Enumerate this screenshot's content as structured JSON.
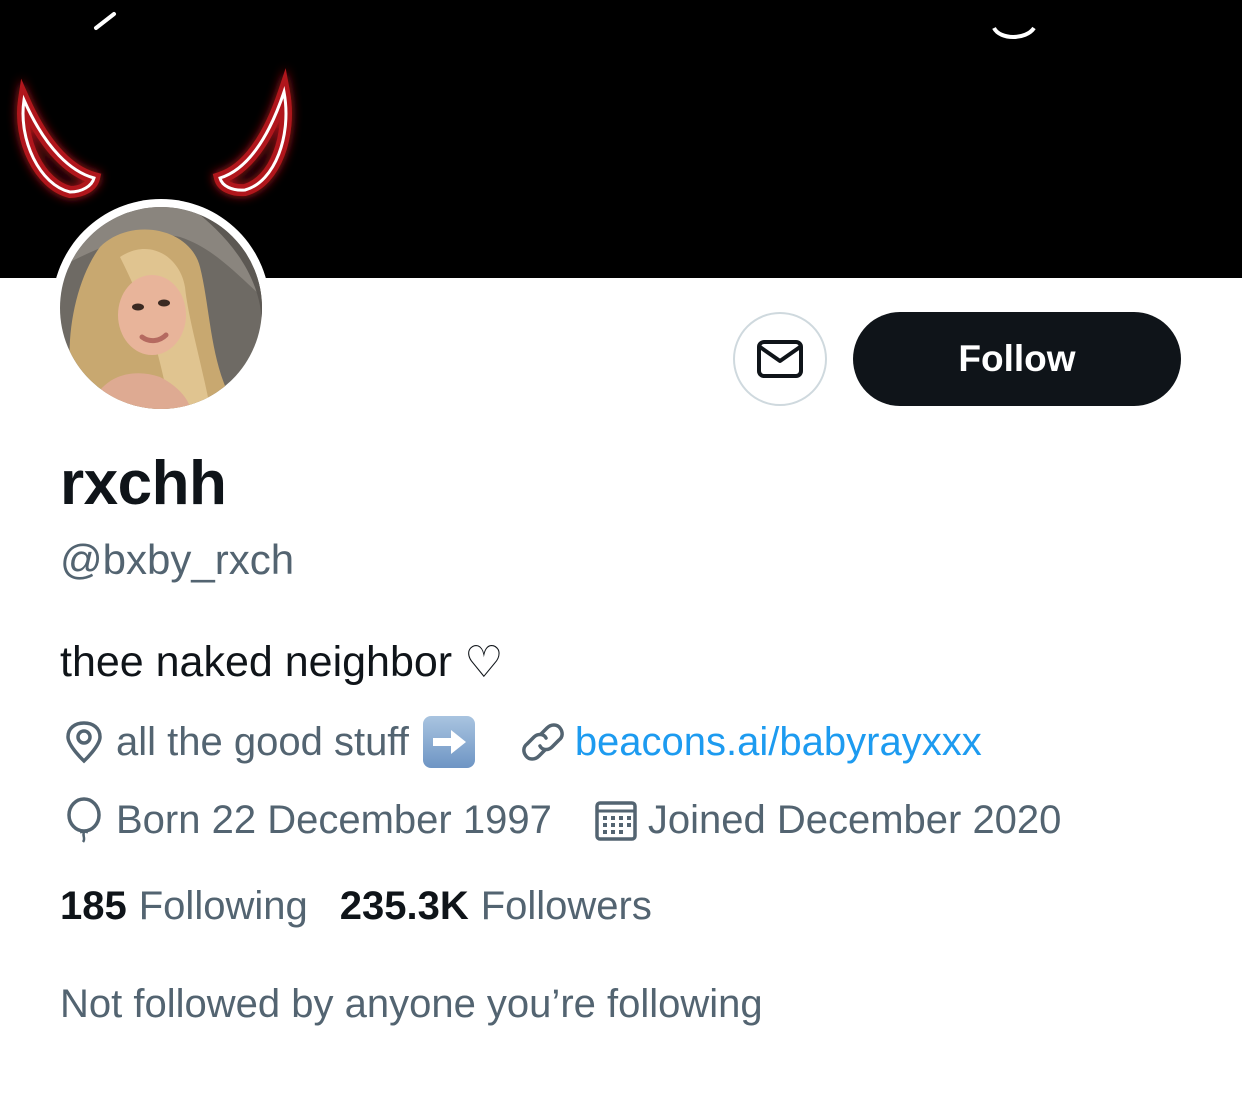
{
  "profile": {
    "display_name": "rxchh",
    "handle": "@bxby_rxch",
    "bio": "thee naked neighbor",
    "bio_emoji": "♡",
    "location": "all the good stuff",
    "location_emoji": "arrow-right-emoji",
    "website": "beacons.ai/babyrayxxx",
    "birthday": "Born 22 December 1997",
    "joined": "Joined December 2020",
    "following_count": "185",
    "following_label": "Following",
    "followers_count": "235.3K",
    "followers_label": "Followers",
    "mutual_text": "Not followed by anyone you’re following"
  },
  "actions": {
    "follow_label": "Follow",
    "message_icon": "envelope-icon"
  },
  "banner": {
    "description_icon": "devil-horns"
  },
  "colors": {
    "text_primary": "#0f1419",
    "text_secondary": "#536471",
    "link": "#1d9bf0",
    "button_bg": "#0f1419",
    "banner_bg": "#000000"
  }
}
